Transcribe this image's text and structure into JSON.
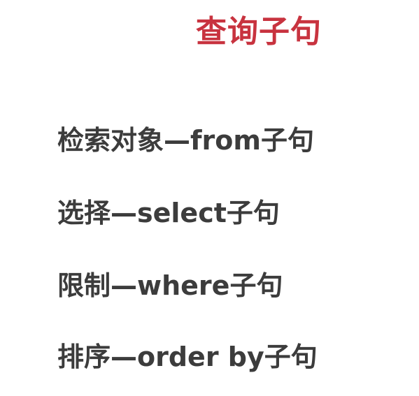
{
  "title": "查询子句",
  "clauses": [
    "检索对象—from子句",
    "选择—select子句",
    "限制—where子句",
    "排序—order by子句"
  ],
  "colors": {
    "title": "#c8333f",
    "text": "#3c3c3c",
    "background": "#ffffff"
  }
}
